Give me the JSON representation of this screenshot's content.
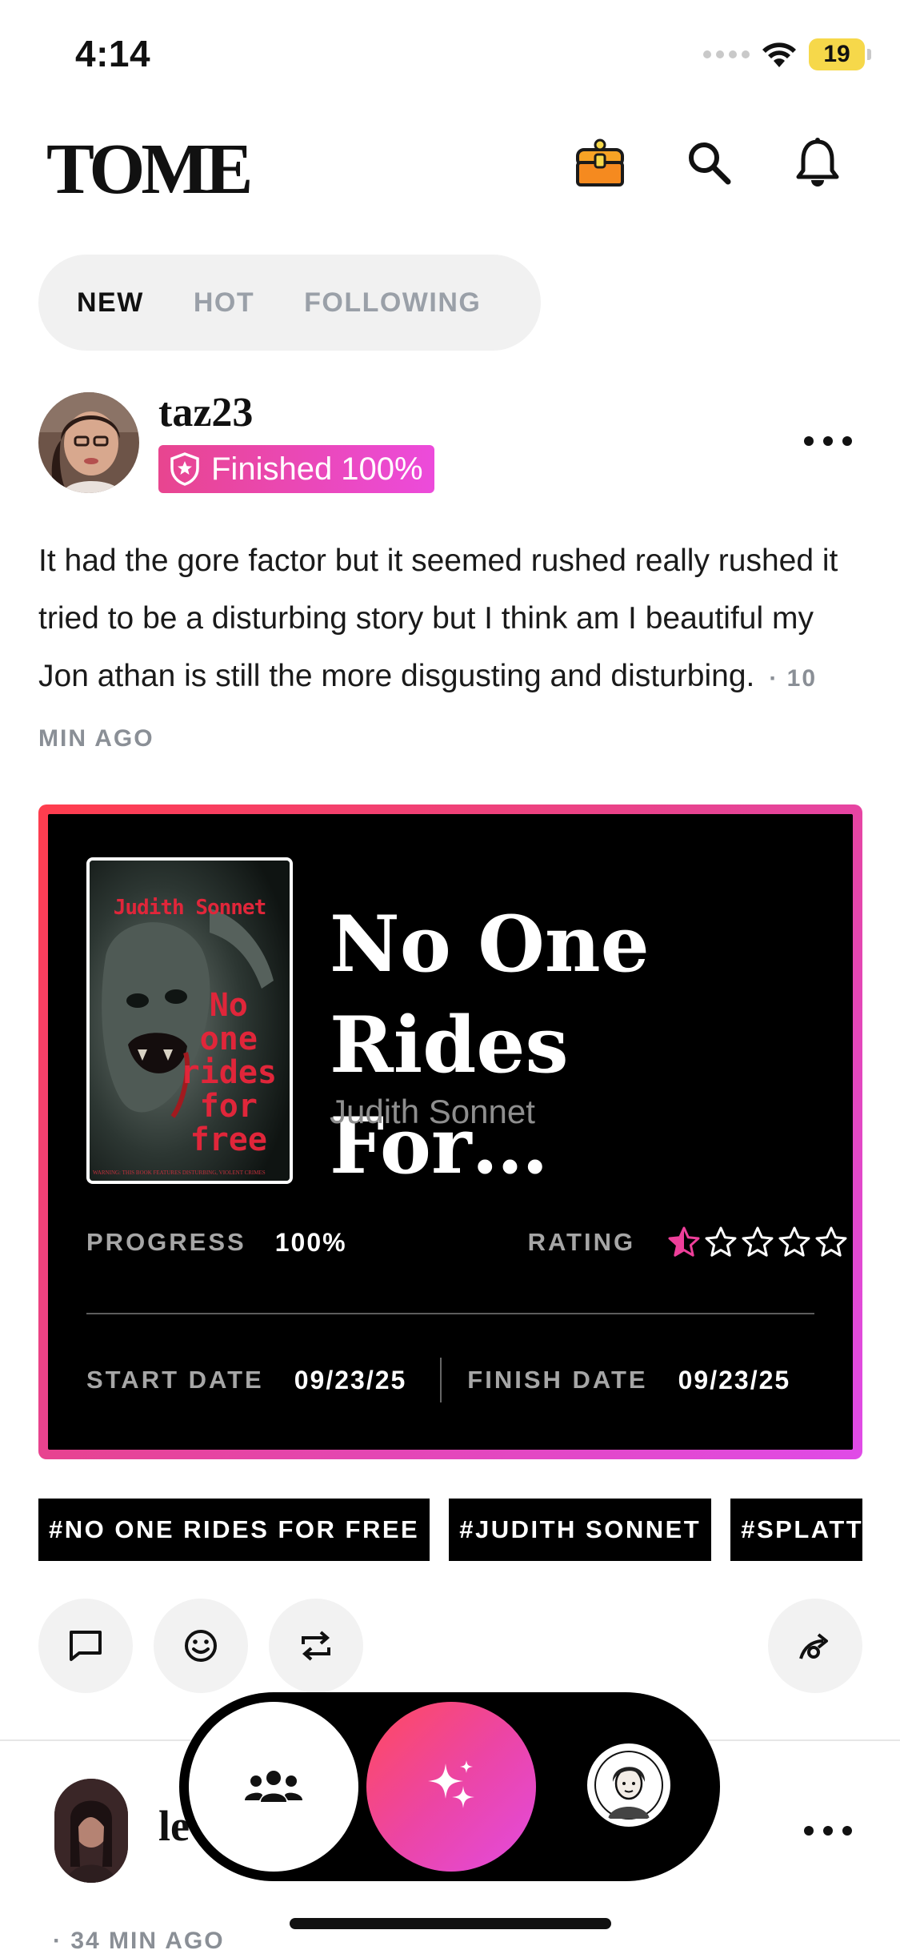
{
  "status_bar": {
    "time": "4:14",
    "battery": "19"
  },
  "header": {
    "brand": "TOME",
    "icons": [
      "treasure-chest-icon",
      "search-icon",
      "bell-icon"
    ]
  },
  "tabs": [
    {
      "label": "NEW",
      "active": true
    },
    {
      "label": "HOT",
      "active": false
    },
    {
      "label": "FOLLOWING",
      "active": false
    }
  ],
  "post": {
    "username": "taz23",
    "badge": "Finished 100%",
    "text": "It had the gore factor but it seemed rushed really rushed it tried to be a disturbing story but I think am I beautiful my Jon athan is still the more disgusting and disturbing.",
    "time": "· 10 MIN AGO",
    "book": {
      "cover_author": "Judith Sonnet",
      "cover_title_lines": [
        "No",
        "one",
        "rides",
        "for",
        "free"
      ],
      "cover_warning": "WARNING: THIS BOOK FEATURES DISTURBING, VIOLENT CRIMES",
      "title": "No One Rides For…",
      "author": "Judith Sonnet",
      "progress_label": "PROGRESS",
      "progress_value": "100%",
      "rating_label": "RATING",
      "rating_value": 0.5,
      "rating_max": 5,
      "start_label": "START DATE",
      "start_value": "09/23/25",
      "finish_label": "FINISH DATE",
      "finish_value": "09/23/25"
    },
    "hashtags": [
      "#NO ONE RIDES FOR FREE",
      "#JUDITH SONNET",
      "#SPLATT"
    ],
    "actions": [
      "comment-icon",
      "emoji-icon",
      "repost-icon",
      "share-icon"
    ]
  },
  "next_post": {
    "username": "le",
    "time": "· 34 MIN AGO"
  },
  "bottom_nav": {
    "items": [
      "community-icon",
      "sparkles-icon",
      "profile-avatar"
    ]
  },
  "colors": {
    "accent_start": "#ff3d4d",
    "accent_end": "#e04be8",
    "badge_start": "#e8458f",
    "badge_end": "#ec4bdb",
    "star_fill": "#ee3f9a",
    "battery": "#f6d84a"
  }
}
